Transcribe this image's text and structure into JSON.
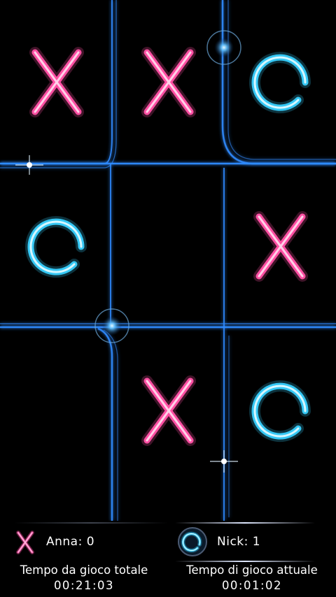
{
  "board": {
    "cells": [
      "X",
      "X",
      "O",
      "O",
      "",
      "X",
      "",
      "X",
      "O"
    ]
  },
  "players": [
    {
      "mark": "X",
      "name": "Anna",
      "score_label": "Anna: 0"
    },
    {
      "mark": "O",
      "name": "Nick",
      "score_label": "Nick: 1"
    }
  ],
  "timers": {
    "total_label": "Tempo da gioco totale",
    "total_value": "00:21:03",
    "current_label": "Tempo di gioco attuale",
    "current_value": "00:01:02"
  },
  "colors": {
    "x_color": "#ff4fa3",
    "o_color": "#35c8f5",
    "grid_color": "#2f8bff",
    "background": "#000000"
  },
  "icons": {
    "x_mark": "neon-x-icon",
    "o_mark": "neon-o-icon"
  }
}
